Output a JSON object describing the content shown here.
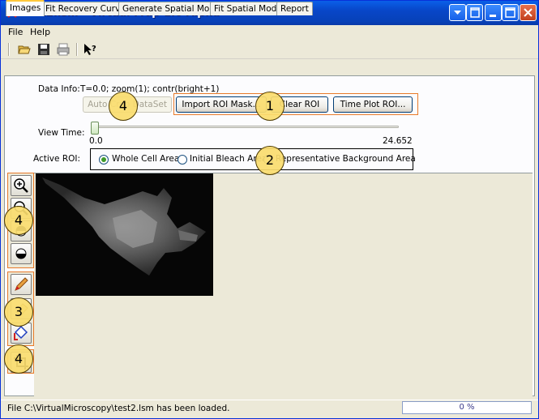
{
  "window": {
    "title": "test2.lsm - Virtual Frap 1.0 Alpha"
  },
  "menu": [
    {
      "label": "File"
    },
    {
      "label": "Help"
    }
  ],
  "toolbar": {
    "icons": [
      "open-folder-icon",
      "save-icon",
      "print-icon",
      "context-help-icon"
    ]
  },
  "tabs": [
    {
      "label": "Images",
      "active": true
    },
    {
      "label": "Fit Recovery Curve"
    },
    {
      "label": "Generate Spatial Model"
    },
    {
      "label": "Fit Spatial Model"
    },
    {
      "label": "Report"
    }
  ],
  "data_info": {
    "label": "Data Info:",
    "value": "T=0.0; zoom(1); contr(bright+1)"
  },
  "buttons": {
    "auto_crop": "Auto Crop DataSet",
    "import_roi": "Import ROI Mask...",
    "clear_roi": "Clear ROI",
    "time_plot": "Time Plot ROI..."
  },
  "view_time": {
    "label": "View Time:",
    "min": "0.0",
    "max": "24.652",
    "value": 0.0
  },
  "active_roi": {
    "label": "Active ROI:",
    "options": [
      {
        "label": "Whole Cell Area",
        "selected": true
      },
      {
        "label": "Initial Bleach Area",
        "selected": false
      },
      {
        "label": "Representative Background Area",
        "selected": false
      }
    ]
  },
  "callouts": [
    "1",
    "2",
    "3",
    "4",
    "4",
    "4"
  ],
  "side_tools": [
    "zoom-in-icon",
    "zoom-out-icon",
    "contrast-up-icon",
    "contrast-down-icon",
    "pencil-icon",
    "eraser-icon",
    "fill-icon",
    "crop-icon"
  ],
  "status": {
    "message": "File C:\\VirtualMicroscopy\\test2.lsm has been loaded.",
    "progress": "0 %"
  },
  "colors": {
    "accent_orange": "#e87a2a",
    "title_blue": "#0a5fe8",
    "callout_yellow": "#fadc6e"
  }
}
